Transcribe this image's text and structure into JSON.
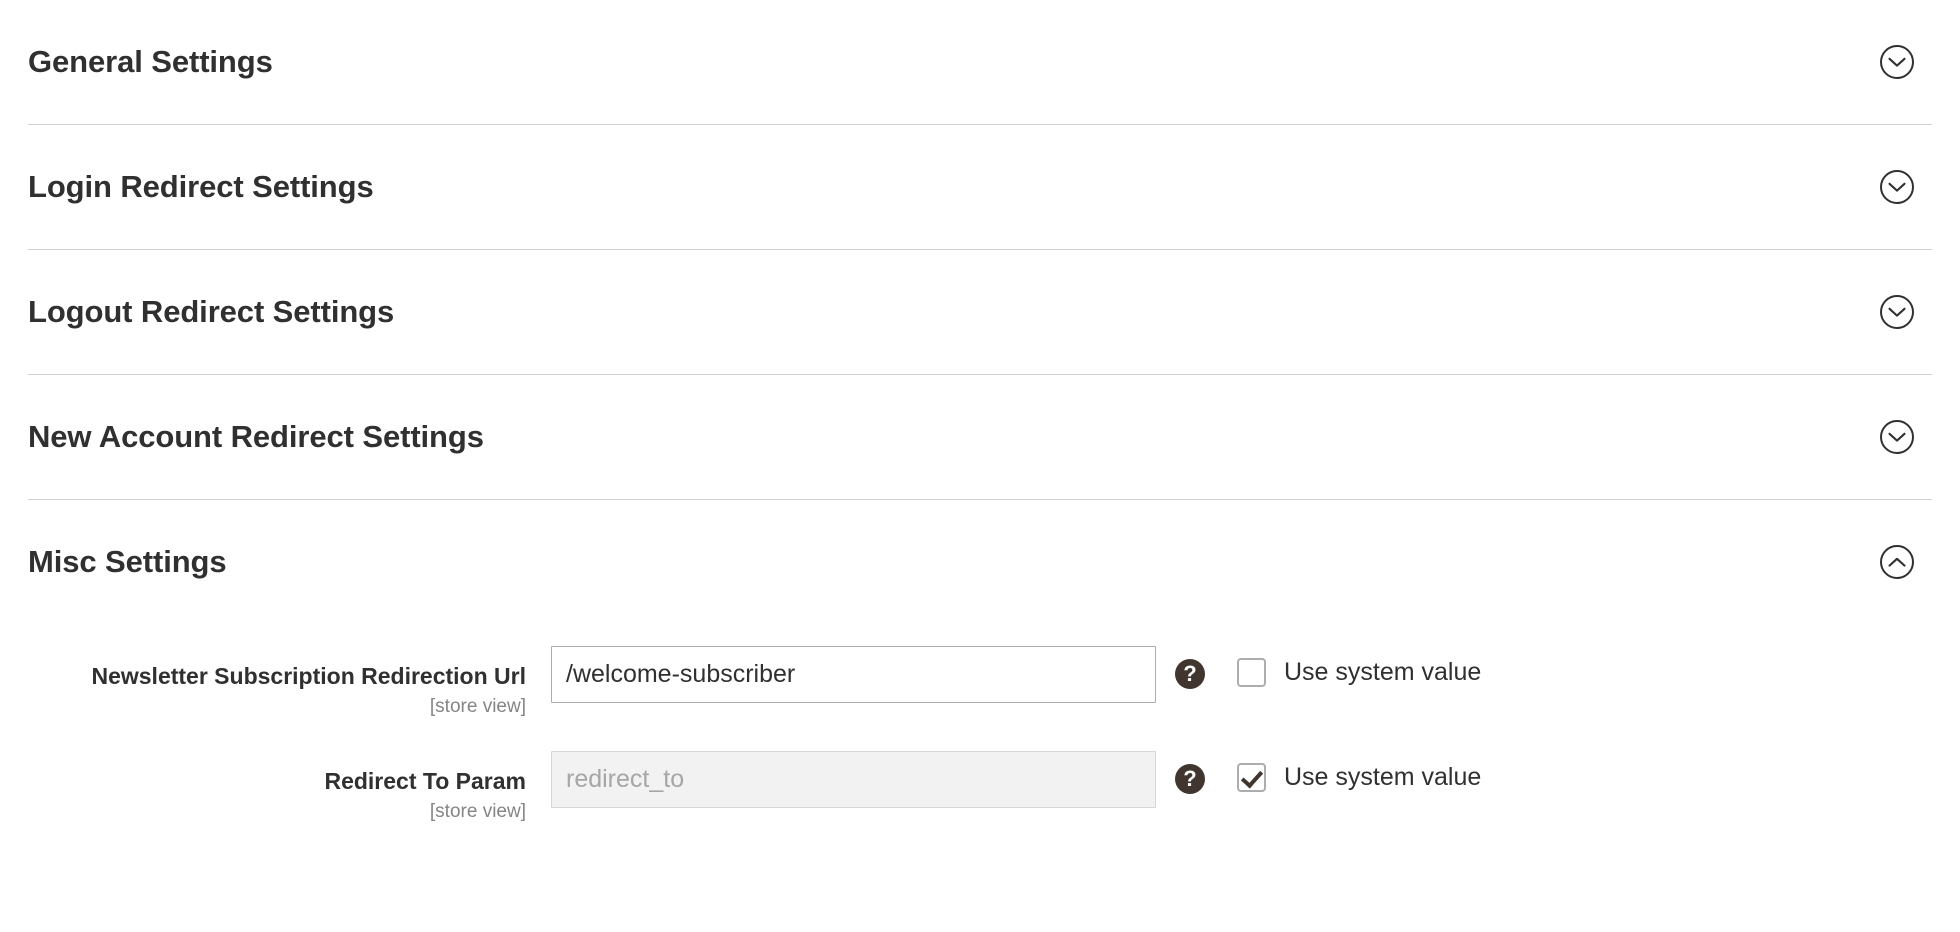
{
  "sections": [
    {
      "id": "general",
      "title": "General Settings",
      "expanded": false,
      "toggle_icon": "chevron-down-icon"
    },
    {
      "id": "login-redirect",
      "title": "Login Redirect Settings",
      "expanded": false,
      "toggle_icon": "chevron-down-icon"
    },
    {
      "id": "logout-redirect",
      "title": "Logout Redirect Settings",
      "expanded": false,
      "toggle_icon": "chevron-down-icon"
    },
    {
      "id": "new-account",
      "title": "New Account Redirect Settings",
      "expanded": false,
      "toggle_icon": "chevron-down-icon"
    },
    {
      "id": "misc",
      "title": "Misc Settings",
      "expanded": true,
      "toggle_icon": "chevron-up-icon"
    }
  ],
  "misc_fields": [
    {
      "label": "Newsletter Subscription Redirection Url",
      "scope": "[store view]",
      "value": "/welcome-subscriber",
      "placeholder": "",
      "disabled": false,
      "help_icon": "help-question-icon",
      "system_value_label": "Use system value",
      "system_value_checked": false
    },
    {
      "label": "Redirect To Param",
      "scope": "[store view]",
      "value": "",
      "placeholder": "redirect_to",
      "disabled": true,
      "help_icon": "help-question-icon",
      "system_value_label": "Use system value",
      "system_value_checked": true
    }
  ],
  "colors": {
    "text": "#303030",
    "scope_text": "#858585",
    "divider": "#d1d1d1",
    "input_border": "#adadad",
    "input_disabled_bg": "#f2f2f2",
    "help_bubble": "#41362f",
    "checkbox_border": "#adadad"
  }
}
